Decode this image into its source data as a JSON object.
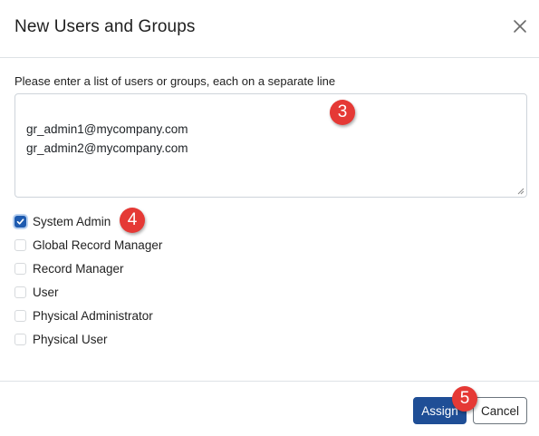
{
  "dialog": {
    "title": "New Users and Groups",
    "close_icon": "close-icon"
  },
  "form": {
    "instruction": "Please enter a list of users or groups, each on a separate line",
    "entries_value": "gr_admin1@mycompany.com\ngr_admin2@mycompany.com"
  },
  "roles": [
    {
      "label": "System Admin",
      "checked": true
    },
    {
      "label": "Global Record Manager",
      "checked": false
    },
    {
      "label": "Record Manager",
      "checked": false
    },
    {
      "label": "User",
      "checked": false
    },
    {
      "label": "Physical Administrator",
      "checked": false
    },
    {
      "label": "Physical User",
      "checked": false
    }
  ],
  "footer": {
    "assign_label": "Assign",
    "cancel_label": "Cancel"
  },
  "annotations": {
    "step3": "3",
    "step4": "4",
    "step5": "5"
  },
  "colors": {
    "primary": "#1f4e96",
    "checkbox_checked": "#1e5bb0",
    "badge": "#e53935"
  }
}
